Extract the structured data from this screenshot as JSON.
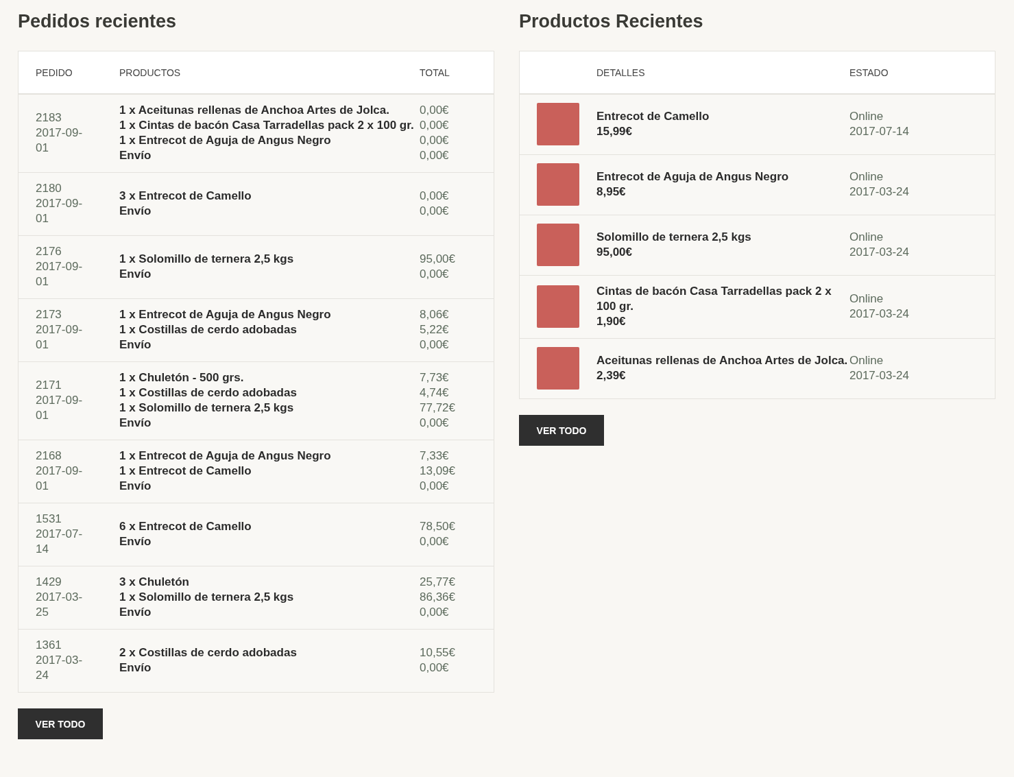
{
  "orders": {
    "title": "Pedidos recientes",
    "columns": [
      "PEDIDO",
      "PRODUCTOS",
      "TOTAL"
    ],
    "rows": [
      {
        "number": "2183",
        "date": "2017-09-01",
        "products": [
          "1 x Aceitunas rellenas de Anchoa Artes de Jolca.",
          "1 x Cintas de bacón Casa Tarradellas pack 2 x 100 gr.",
          "1 x Entrecot de Aguja de Angus Negro",
          "Envío"
        ],
        "totals": [
          "0,00€",
          "0,00€",
          "0,00€",
          "0,00€"
        ]
      },
      {
        "number": "2180",
        "date": "2017-09-01",
        "products": [
          "3 x Entrecot de Camello",
          "Envío"
        ],
        "totals": [
          "0,00€",
          "0,00€"
        ]
      },
      {
        "number": "2176",
        "date": "2017-09-01",
        "products": [
          "1 x Solomillo de ternera 2,5 kgs",
          "Envío"
        ],
        "totals": [
          "95,00€",
          "0,00€"
        ]
      },
      {
        "number": "2173",
        "date": "2017-09-01",
        "products": [
          "1 x Entrecot de Aguja de Angus Negro",
          "1 x Costillas de cerdo adobadas",
          "Envío"
        ],
        "totals": [
          "8,06€",
          "5,22€",
          "0,00€"
        ]
      },
      {
        "number": "2171",
        "date": "2017-09-01",
        "products": [
          "1 x Chuletón - 500 grs.",
          "1 x Costillas de cerdo adobadas",
          "1 x Solomillo de ternera 2,5 kgs",
          "Envío"
        ],
        "totals": [
          "7,73€",
          "4,74€",
          "77,72€",
          "0,00€"
        ]
      },
      {
        "number": "2168",
        "date": "2017-09-01",
        "products": [
          "1 x Entrecot de Aguja de Angus Negro",
          "1 x Entrecot de Camello",
          "Envío"
        ],
        "totals": [
          "7,33€",
          "13,09€",
          "0,00€"
        ]
      },
      {
        "number": "1531",
        "date": "2017-07-14",
        "products": [
          "6 x Entrecot de Camello",
          "Envío"
        ],
        "totals": [
          "78,50€",
          "0,00€"
        ]
      },
      {
        "number": "1429",
        "date": "2017-03-25",
        "products": [
          "3 x Chuletón",
          "1 x Solomillo de ternera 2,5 kgs",
          "Envío"
        ],
        "totals": [
          "25,77€",
          "86,36€",
          "0,00€"
        ]
      },
      {
        "number": "1361",
        "date": "2017-03-24",
        "products": [
          "2 x Costillas de cerdo adobadas",
          "Envío"
        ],
        "totals": [
          "10,55€",
          "0,00€"
        ]
      }
    ],
    "button": "VER TODO"
  },
  "products": {
    "title": "Productos Recientes",
    "columns": [
      "DETALLES",
      "ESTADO"
    ],
    "rows": [
      {
        "name": "Entrecot de Camello",
        "price": "15,99€",
        "status": "Online",
        "date": "2017-07-14"
      },
      {
        "name": "Entrecot de Aguja de Angus Negro",
        "price": "8,95€",
        "status": "Online",
        "date": "2017-03-24"
      },
      {
        "name": "Solomillo de ternera 2,5 kgs",
        "price": "95,00€",
        "status": "Online",
        "date": "2017-03-24"
      },
      {
        "name": "Cintas de bacón Casa Tarradellas pack 2 x 100 gr.",
        "price": "1,90€",
        "status": "Online",
        "date": "2017-03-24"
      },
      {
        "name": "Aceitunas rellenas de Anchoa Artes de Jolca.",
        "price": "2,39€",
        "status": "Online",
        "date": "2017-03-24"
      }
    ],
    "button": "VER TODO"
  }
}
